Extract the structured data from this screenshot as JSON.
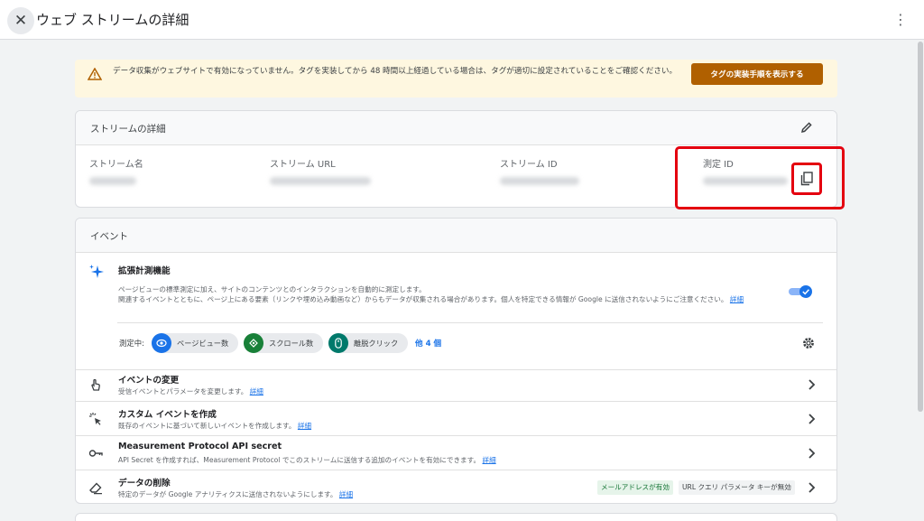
{
  "header": {
    "title": "ウェブ ストリームの詳細",
    "close_icon": "close-icon",
    "menu_icon": "more-vert-icon"
  },
  "warning": {
    "icon": "warning-icon",
    "text": "データ収集がウェブサイトで有効になっていません。タグを実装してから 48 時間以上経過している場合は、タグが適切に設定されていることをご確認ください。",
    "button_label": "タグの実装手順を表示する",
    "accent": "#b06000"
  },
  "stream_details": {
    "heading": "ストリームの詳細",
    "edit_icon": "pencil-icon",
    "fields": [
      {
        "label": "ストリーム名"
      },
      {
        "label": "ストリーム URL"
      },
      {
        "label": "ストリーム ID"
      },
      {
        "label": "測定 ID"
      }
    ],
    "copy_icon": "copy-icon",
    "highlight_color": "#e4000f"
  },
  "events": {
    "heading": "イベント",
    "enhanced": {
      "icon": "sparkle-icon",
      "title": "拡張計測機能",
      "desc_line1": "ページビューの標準測定に加え、サイトのコンテンツとのインタラクションを自動的に測定します。",
      "desc_line2": "関連するイベントとともに、ページ上にある要素（リンクや埋め込み動画など）からもデータが収集される場合があります。個人を特定できる情報が Google に送信されないようにご注意ください。",
      "link": "詳細",
      "toggle_on": true,
      "measuring_label": "測定中:",
      "chips": [
        {
          "label": "ページビュー数",
          "icon": "eye-icon",
          "color": "#1a73e8"
        },
        {
          "label": "スクロール数",
          "icon": "scroll-icon",
          "color": "#188038"
        },
        {
          "label": "離脱クリック",
          "icon": "mouse-icon",
          "color": "#00796b"
        }
      ],
      "more_label": "他 4 個",
      "settings_icon": "gear-icon"
    },
    "rows": [
      {
        "icon": "touch-icon",
        "title": "イベントの変更",
        "sub": "受信イベントとパラメータを変更します。",
        "link": "詳細"
      },
      {
        "icon": "click-icon",
        "title": "カスタム イベントを作成",
        "sub": "既存のイベントに基づいて新しいイベントを作成します。",
        "link": "詳細"
      },
      {
        "icon": "key-icon",
        "title": "Measurement Protocol API secret",
        "sub": "API Secret を作成すれば、Measurement Protocol でこのストリームに送信する追加のイベントを有効にできます。",
        "link": "詳細"
      },
      {
        "icon": "eraser-icon",
        "title": "データの削除",
        "sub": "特定のデータが Google アナリティクスに送信されないようにします。",
        "link": "詳細",
        "tags": [
          "メールアドレスが有効",
          "URL クエリ パラメータ キーが無効"
        ]
      }
    ]
  }
}
